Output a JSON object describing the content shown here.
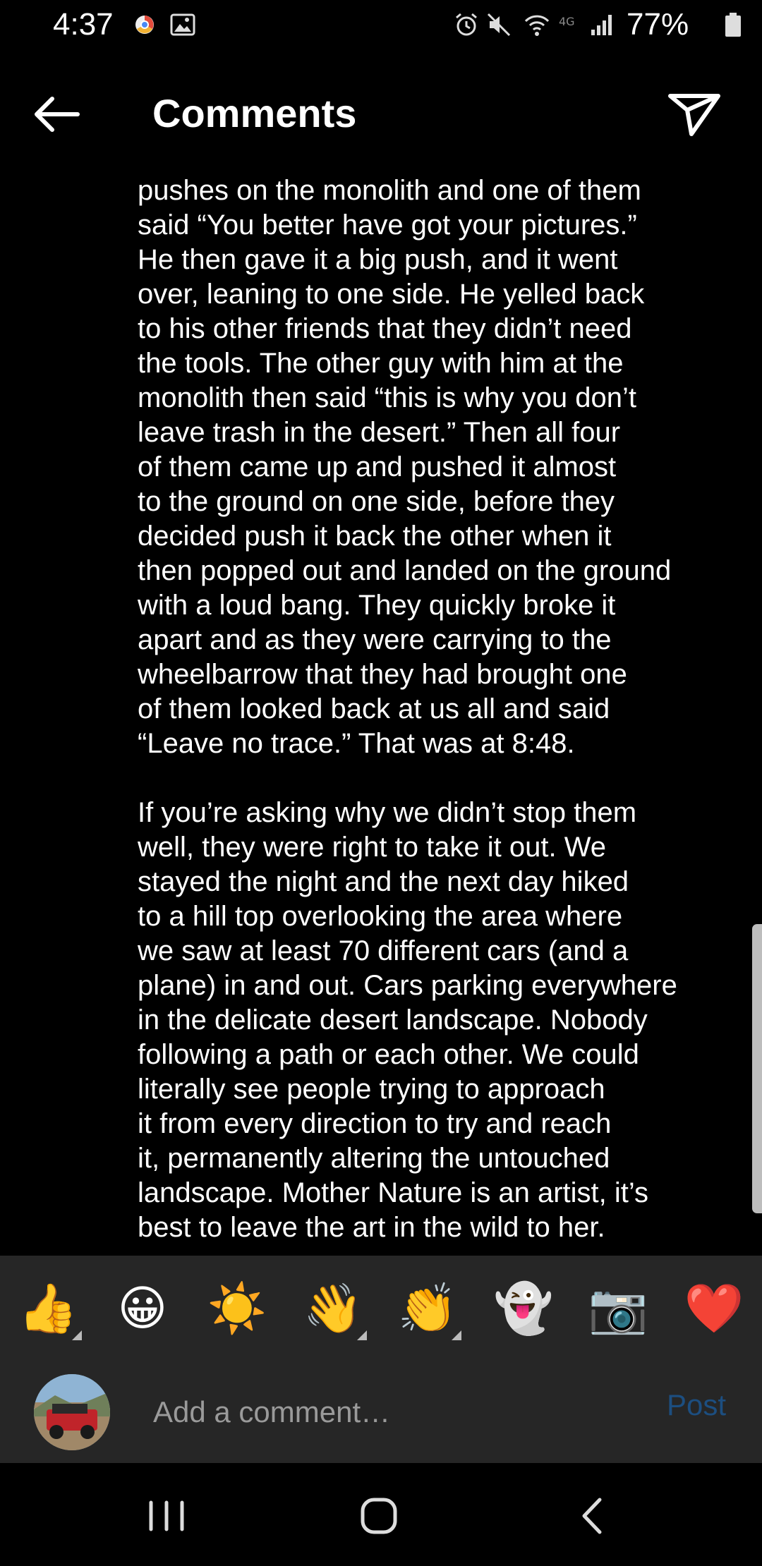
{
  "status_bar": {
    "time": "4:37",
    "battery": "77%",
    "icons": [
      "chrome-icon",
      "gallery-icon",
      "alarm-icon",
      "mute-icon",
      "wifi-icon",
      "4g-icon",
      "signal-icon",
      "battery-icon"
    ]
  },
  "header": {
    "title": "Comments",
    "back_icon": "back-arrow-icon",
    "send_icon": "send-icon"
  },
  "comment": {
    "paragraphs": [
      "pushes on the monolith and one of them\nsaid “You better have got your pictures.”\nHe then gave it a big push, and it  went\nover, leaning to one side. He yelled back\nto his other friends that they didn’t need\nthe tools. The other guy with him at the\nmonolith then said “this is why you don’t\nleave trash in the desert.” Then all four\nof them came up and pushed it almost\nto the ground on one side, before they\ndecided push it back the other when it\nthen popped out and landed on the ground\nwith a loud bang. They quickly broke it\napart and as they were carrying to the\nwheelbarrow that they had brought one\nof them looked back at us all and said\n“Leave no trace.” That was at 8:48.",
      "If you’re asking why we didn’t stop them\nwell, they were right to take it out. We\nstayed the night and the next day hiked\nto a hill top overlooking the area where\nwe saw at least 70 different cars (and a\nplane) in and out. Cars parking everywhere\nin the delicate desert landscape. Nobody\nfollowing a path or each other. We could\nliterally see people trying to approach\nit from every direction to try and reach\nit, permanently altering the untouched\nlandscape. Mother Nature is an artist, it’s\nbest to leave the art in the wild to her."
    ]
  },
  "emoji_bar": {
    "emojis": [
      {
        "char": "👍",
        "name": "thumbs-up",
        "has_variants": true
      },
      {
        "char": "😀",
        "name": "grinning-face",
        "has_variants": false
      },
      {
        "char": "☀️",
        "name": "sun",
        "has_variants": false
      },
      {
        "char": "👋",
        "name": "waving-hand",
        "has_variants": true
      },
      {
        "char": "👏",
        "name": "clapping-hands",
        "has_variants": true
      },
      {
        "char": "👻",
        "name": "ghost",
        "has_variants": false
      },
      {
        "char": "📷",
        "name": "camera",
        "has_variants": false
      },
      {
        "char": "❤️",
        "name": "red-heart",
        "has_variants": false
      }
    ]
  },
  "add_comment": {
    "placeholder": "Add a comment…",
    "post_label": "Post",
    "post_color": "#1c4e80",
    "avatar": "user-avatar"
  },
  "nav_bar": {
    "buttons": [
      "recent-apps-icon",
      "home-icon",
      "back-icon"
    ]
  }
}
